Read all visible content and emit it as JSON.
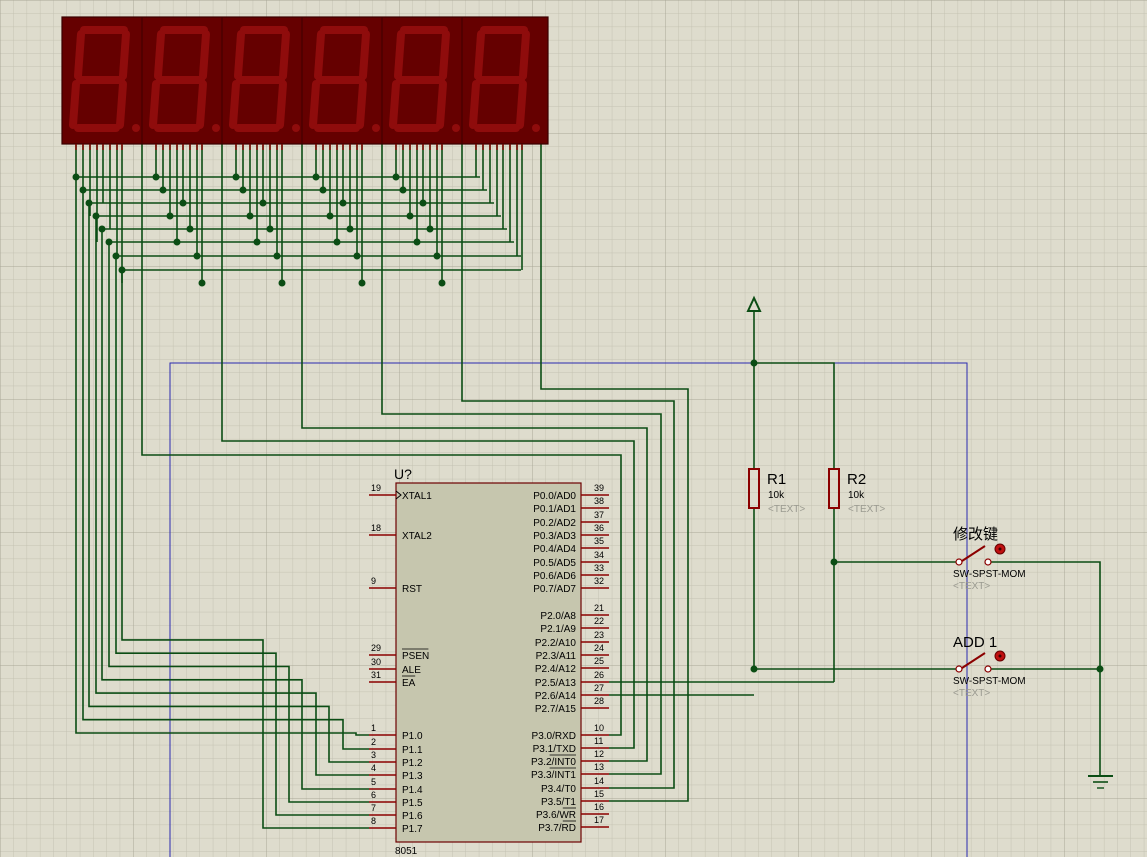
{
  "chip": {
    "ref": "U?",
    "part": "8051",
    "left_pins": [
      {
        "num": "19",
        "name": "XTAL1"
      },
      {
        "num": "18",
        "name": "XTAL2"
      },
      {
        "num": "9",
        "name": "RST"
      },
      {
        "num": "29",
        "name": "PSEN"
      },
      {
        "num": "30",
        "name": "ALE"
      },
      {
        "num": "31",
        "name": "EA"
      },
      {
        "num": "1",
        "name": "P1.0"
      },
      {
        "num": "2",
        "name": "P1.1"
      },
      {
        "num": "3",
        "name": "P1.2"
      },
      {
        "num": "4",
        "name": "P1.3"
      },
      {
        "num": "5",
        "name": "P1.4"
      },
      {
        "num": "6",
        "name": "P1.5"
      },
      {
        "num": "7",
        "name": "P1.6"
      },
      {
        "num": "8",
        "name": "P1.7"
      }
    ],
    "right_pins": [
      {
        "num": "39",
        "name": "P0.0/AD0"
      },
      {
        "num": "38",
        "name": "P0.1/AD1"
      },
      {
        "num": "37",
        "name": "P0.2/AD2"
      },
      {
        "num": "36",
        "name": "P0.3/AD3"
      },
      {
        "num": "35",
        "name": "P0.4/AD4"
      },
      {
        "num": "34",
        "name": "P0.5/AD5"
      },
      {
        "num": "33",
        "name": "P0.6/AD6"
      },
      {
        "num": "32",
        "name": "P0.7/AD7"
      },
      {
        "num": "21",
        "name": "P2.0/A8"
      },
      {
        "num": "22",
        "name": "P2.1/A9"
      },
      {
        "num": "23",
        "name": "P2.2/A10"
      },
      {
        "num": "24",
        "name": "P2.3/A11"
      },
      {
        "num": "25",
        "name": "P2.4/A12"
      },
      {
        "num": "26",
        "name": "P2.5/A13"
      },
      {
        "num": "27",
        "name": "P2.6/A14"
      },
      {
        "num": "28",
        "name": "P2.7/A15"
      },
      {
        "num": "10",
        "name": "P3.0/RXD"
      },
      {
        "num": "11",
        "name": "P3.1/TXD"
      },
      {
        "num": "12",
        "name": "P3.2/INT0"
      },
      {
        "num": "13",
        "name": "P3.3/INT1"
      },
      {
        "num": "14",
        "name": "P3.4/T0"
      },
      {
        "num": "15",
        "name": "P3.5/T1"
      },
      {
        "num": "16",
        "name": "P3.6/WR"
      },
      {
        "num": "17",
        "name": "P3.7/RD"
      }
    ]
  },
  "resistors": [
    {
      "ref": "R1",
      "value": "10k",
      "text": "<TEXT>"
    },
    {
      "ref": "R2",
      "value": "10k",
      "text": "<TEXT>"
    }
  ],
  "switches": [
    {
      "label": "修改键",
      "part": "SW-SPST-MOM",
      "text": "<TEXT>"
    },
    {
      "label": "ADD 1",
      "part": "SW-SPST-MOM",
      "text": "<TEXT>"
    }
  ],
  "display": {
    "digits": 6,
    "segment_color": "#8f0c0c",
    "body_color": "#650000"
  },
  "colors": {
    "wire": "#0b4d14",
    "pin": "#8b0000",
    "chip_fill": "#c6c6ae",
    "grid_bg": "#dedccd",
    "border_blue": "#2a2ab0"
  }
}
